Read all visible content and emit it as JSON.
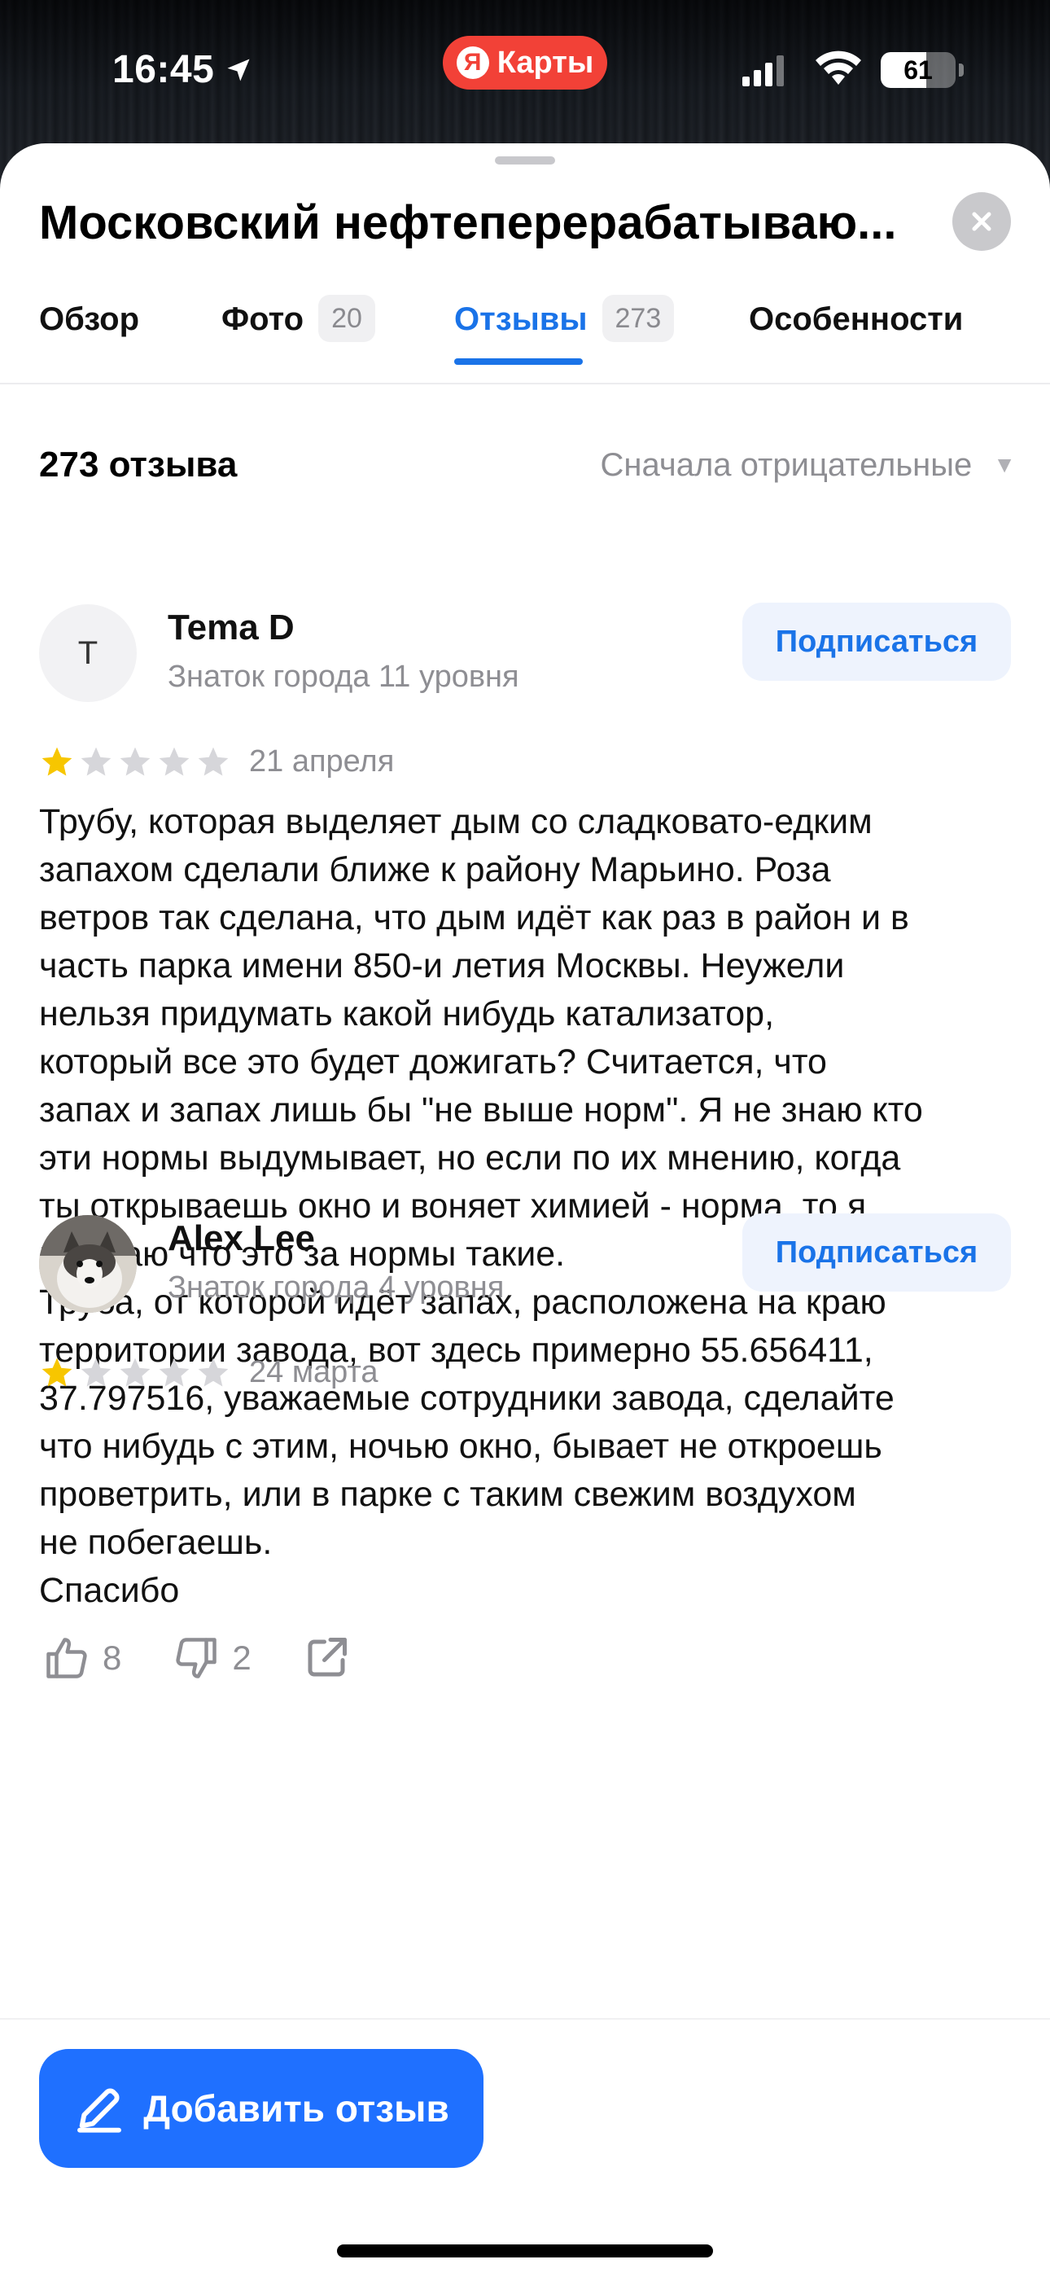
{
  "status_bar": {
    "time": "16:45",
    "app_pill": "Карты",
    "app_logo": "Я",
    "battery_level": 61,
    "battery_text": "61"
  },
  "place": {
    "title": "Московский нефтеперерабатываю..."
  },
  "tabs": [
    {
      "label": "Обзор",
      "count": ""
    },
    {
      "label": "Фото",
      "count": "20"
    },
    {
      "label": "Отзывы",
      "count": "273",
      "active": true
    },
    {
      "label": "Особенности",
      "count": ""
    }
  ],
  "reviews_header": {
    "count_text": "273 отзыва",
    "sort_label": "Сначала отрицательные"
  },
  "reviews": [
    {
      "author": "Tema D",
      "avatar_letter": "T",
      "level": "Знаток города 11 уровня",
      "subscribe_label": "Подписаться",
      "rating": 1,
      "date": "21 апреля",
      "text": "Трубу, которая выделяет дым со сладковато-едким\nзапахом сделали ближе к району Марьино. Роза\nветров так сделана, что дым идёт как раз в район и в\nчасть парка имени 850-и летия Москвы. Неужели\nнельзя придумать какой нибудь катализатор,\nкоторый все это будет дожигать? Считается, что\nзапах и запах лишь бы \"не выше норм\". Я не знаю кто\nэти нормы выдумывает, но если по их мнению, когда\nты открываешь окно и воняет химией - норма, то я\nне знаю что это за нормы такие.\nТруба, от которой идёт запах, расположена на краю\nтерритории завода, вот здесь примерно 55.656411,\n37.797516, уважаемые сотрудники завода, сделайте\nчто нибудь с этим, ночью окно, бывает не откроешь\nпроветрить, или в парке с таким свежим воздухом\nне побегаешь.\nСпасибо",
      "likes": "8",
      "dislikes": "2"
    },
    {
      "author": "Alex Lee",
      "level": "Знаток города 4 уровня",
      "subscribe_label": "Подписаться",
      "rating": 1,
      "date": "24 марта"
    }
  ],
  "bottom": {
    "add_review_label": "Добавить отзыв"
  },
  "icons": {
    "location": "location-arrow-icon",
    "signal": "cellular-signal-icon",
    "wifi": "wifi-icon",
    "close": "close-icon",
    "caret": "caret-down-icon",
    "star": "star-icon",
    "like": "thumbs-up-icon",
    "dislike": "thumbs-down-icon",
    "share": "share-icon",
    "pencil": "pencil-icon"
  },
  "colors": {
    "accent": "#1a73e8",
    "button": "#1f70ff",
    "star_filled": "#f7c600",
    "star_empty": "#d6d6da",
    "ya_red": "#f24137"
  }
}
